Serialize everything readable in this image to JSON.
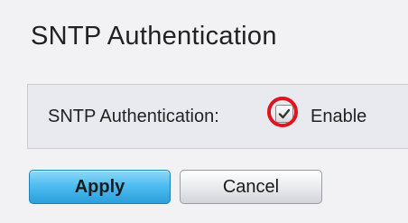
{
  "header": {
    "title": "SNTP Authentication"
  },
  "form": {
    "field_label": "SNTP Authentication:",
    "checkbox_checked": true,
    "checkbox_label": "Enable",
    "highlight_color": "#e0141e"
  },
  "buttons": {
    "apply_label": "Apply",
    "cancel_label": "Cancel"
  },
  "colors": {
    "apply_accent": "#4fbdf0"
  }
}
